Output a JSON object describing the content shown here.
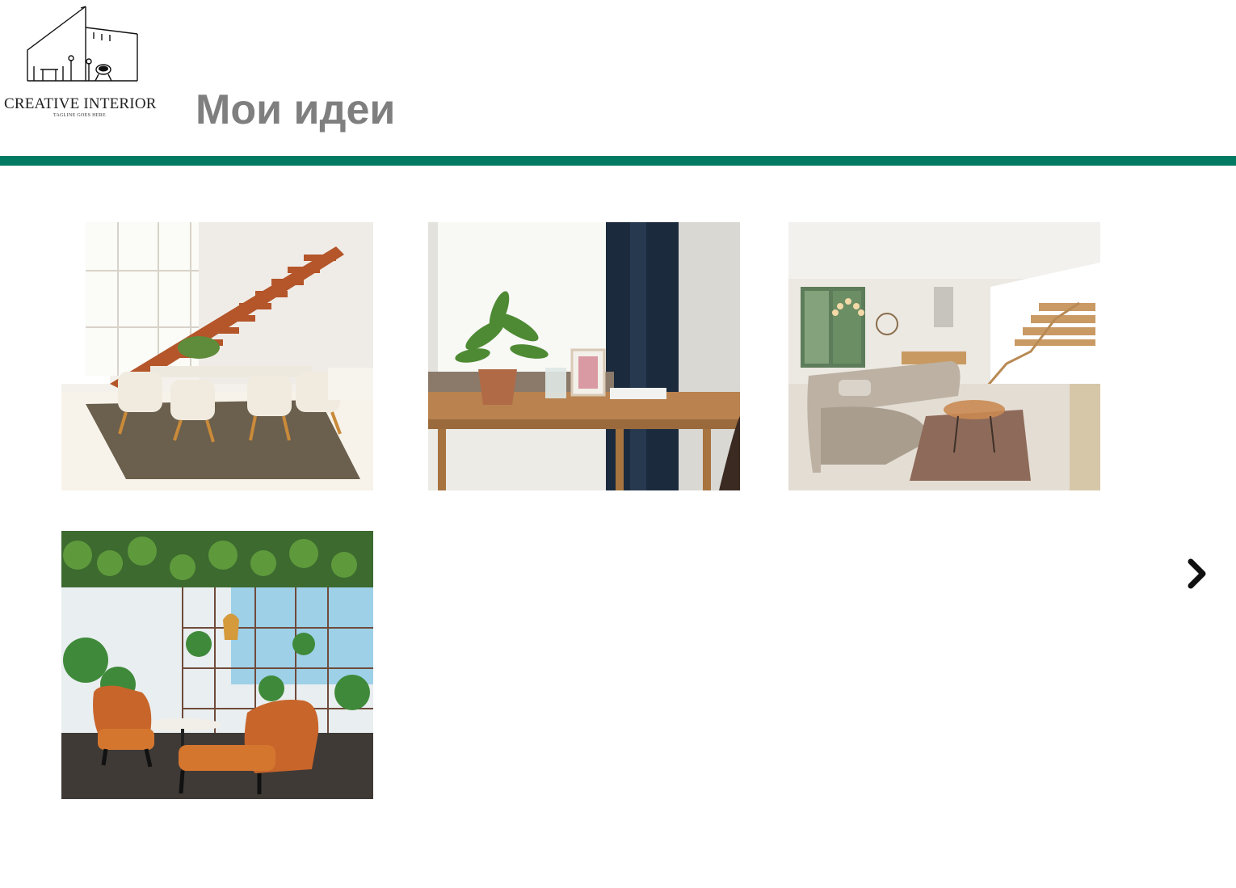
{
  "brand": {
    "name": "CREATIVE INTERIOR",
    "tagline": "TAGLINE GOES HERE"
  },
  "page": {
    "title": "Мои идеи"
  },
  "colors": {
    "accent": "#007a63",
    "title": "#7f7f7f",
    "background": "#ffffff"
  },
  "gallery": {
    "images": [
      {
        "subject": "dining area with floating wooden staircase"
      },
      {
        "subject": "wooden desk with potted plant by window"
      },
      {
        "subject": "living room with beige sofa and staircase"
      },
      {
        "subject": "lounge with orange armchairs and plant shelving"
      }
    ]
  },
  "navigation": {
    "next_icon": "chevron-right-icon"
  }
}
